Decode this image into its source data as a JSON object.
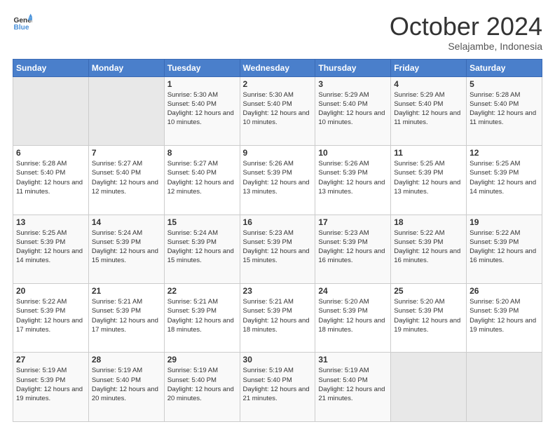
{
  "header": {
    "logo_line1": "General",
    "logo_line2": "Blue",
    "month": "October 2024",
    "location": "Selajambe, Indonesia"
  },
  "weekdays": [
    "Sunday",
    "Monday",
    "Tuesday",
    "Wednesday",
    "Thursday",
    "Friday",
    "Saturday"
  ],
  "weeks": [
    [
      {
        "day": "",
        "info": ""
      },
      {
        "day": "",
        "info": ""
      },
      {
        "day": "1",
        "info": "Sunrise: 5:30 AM\nSunset: 5:40 PM\nDaylight: 12 hours and 10 minutes."
      },
      {
        "day": "2",
        "info": "Sunrise: 5:30 AM\nSunset: 5:40 PM\nDaylight: 12 hours and 10 minutes."
      },
      {
        "day": "3",
        "info": "Sunrise: 5:29 AM\nSunset: 5:40 PM\nDaylight: 12 hours and 10 minutes."
      },
      {
        "day": "4",
        "info": "Sunrise: 5:29 AM\nSunset: 5:40 PM\nDaylight: 12 hours and 11 minutes."
      },
      {
        "day": "5",
        "info": "Sunrise: 5:28 AM\nSunset: 5:40 PM\nDaylight: 12 hours and 11 minutes."
      }
    ],
    [
      {
        "day": "6",
        "info": "Sunrise: 5:28 AM\nSunset: 5:40 PM\nDaylight: 12 hours and 11 minutes."
      },
      {
        "day": "7",
        "info": "Sunrise: 5:27 AM\nSunset: 5:40 PM\nDaylight: 12 hours and 12 minutes."
      },
      {
        "day": "8",
        "info": "Sunrise: 5:27 AM\nSunset: 5:40 PM\nDaylight: 12 hours and 12 minutes."
      },
      {
        "day": "9",
        "info": "Sunrise: 5:26 AM\nSunset: 5:39 PM\nDaylight: 12 hours and 13 minutes."
      },
      {
        "day": "10",
        "info": "Sunrise: 5:26 AM\nSunset: 5:39 PM\nDaylight: 12 hours and 13 minutes."
      },
      {
        "day": "11",
        "info": "Sunrise: 5:25 AM\nSunset: 5:39 PM\nDaylight: 12 hours and 13 minutes."
      },
      {
        "day": "12",
        "info": "Sunrise: 5:25 AM\nSunset: 5:39 PM\nDaylight: 12 hours and 14 minutes."
      }
    ],
    [
      {
        "day": "13",
        "info": "Sunrise: 5:25 AM\nSunset: 5:39 PM\nDaylight: 12 hours and 14 minutes."
      },
      {
        "day": "14",
        "info": "Sunrise: 5:24 AM\nSunset: 5:39 PM\nDaylight: 12 hours and 15 minutes."
      },
      {
        "day": "15",
        "info": "Sunrise: 5:24 AM\nSunset: 5:39 PM\nDaylight: 12 hours and 15 minutes."
      },
      {
        "day": "16",
        "info": "Sunrise: 5:23 AM\nSunset: 5:39 PM\nDaylight: 12 hours and 15 minutes."
      },
      {
        "day": "17",
        "info": "Sunrise: 5:23 AM\nSunset: 5:39 PM\nDaylight: 12 hours and 16 minutes."
      },
      {
        "day": "18",
        "info": "Sunrise: 5:22 AM\nSunset: 5:39 PM\nDaylight: 12 hours and 16 minutes."
      },
      {
        "day": "19",
        "info": "Sunrise: 5:22 AM\nSunset: 5:39 PM\nDaylight: 12 hours and 16 minutes."
      }
    ],
    [
      {
        "day": "20",
        "info": "Sunrise: 5:22 AM\nSunset: 5:39 PM\nDaylight: 12 hours and 17 minutes."
      },
      {
        "day": "21",
        "info": "Sunrise: 5:21 AM\nSunset: 5:39 PM\nDaylight: 12 hours and 17 minutes."
      },
      {
        "day": "22",
        "info": "Sunrise: 5:21 AM\nSunset: 5:39 PM\nDaylight: 12 hours and 18 minutes."
      },
      {
        "day": "23",
        "info": "Sunrise: 5:21 AM\nSunset: 5:39 PM\nDaylight: 12 hours and 18 minutes."
      },
      {
        "day": "24",
        "info": "Sunrise: 5:20 AM\nSunset: 5:39 PM\nDaylight: 12 hours and 18 minutes."
      },
      {
        "day": "25",
        "info": "Sunrise: 5:20 AM\nSunset: 5:39 PM\nDaylight: 12 hours and 19 minutes."
      },
      {
        "day": "26",
        "info": "Sunrise: 5:20 AM\nSunset: 5:39 PM\nDaylight: 12 hours and 19 minutes."
      }
    ],
    [
      {
        "day": "27",
        "info": "Sunrise: 5:19 AM\nSunset: 5:39 PM\nDaylight: 12 hours and 19 minutes."
      },
      {
        "day": "28",
        "info": "Sunrise: 5:19 AM\nSunset: 5:40 PM\nDaylight: 12 hours and 20 minutes."
      },
      {
        "day": "29",
        "info": "Sunrise: 5:19 AM\nSunset: 5:40 PM\nDaylight: 12 hours and 20 minutes."
      },
      {
        "day": "30",
        "info": "Sunrise: 5:19 AM\nSunset: 5:40 PM\nDaylight: 12 hours and 21 minutes."
      },
      {
        "day": "31",
        "info": "Sunrise: 5:19 AM\nSunset: 5:40 PM\nDaylight: 12 hours and 21 minutes."
      },
      {
        "day": "",
        "info": ""
      },
      {
        "day": "",
        "info": ""
      }
    ]
  ]
}
